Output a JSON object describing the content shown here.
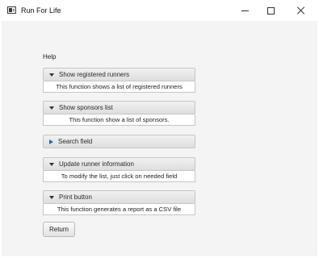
{
  "window": {
    "title": "Run For Life"
  },
  "help": {
    "label": "Help"
  },
  "panes": [
    {
      "header": "Show registered runners",
      "content": "This function shows a list of registered runners",
      "expanded": true
    },
    {
      "header": "Show sponsors list",
      "content": "This function show a list of sponsors.",
      "expanded": true
    },
    {
      "header": "Search field",
      "content": "",
      "expanded": false
    },
    {
      "header": "Update runner information",
      "content": "To modify the list, just click on needed field",
      "expanded": true
    },
    {
      "header": "Print button",
      "content": "This function generates a report as a CSV file",
      "expanded": true
    }
  ],
  "buttons": {
    "return": "Return"
  },
  "icons": {
    "app": "app-window-icon",
    "minimize": "minimize-icon",
    "maximize": "maximize-icon",
    "close": "close-icon",
    "expanded_arrow": "triangle-down-icon",
    "collapsed_arrow": "triangle-right-icon"
  },
  "colors": {
    "accent_arrow": "#1f6bb5",
    "client_background": "#f4f4f4"
  }
}
